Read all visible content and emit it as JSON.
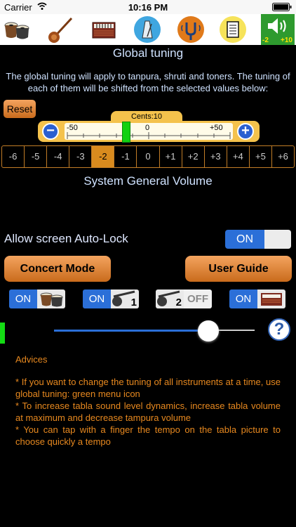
{
  "status": {
    "carrier": "Carrier",
    "time": "10:16 PM"
  },
  "toolbar": {
    "icons": [
      "tabla-icon",
      "sitar-icon",
      "harmonium-icon",
      "metronome-icon",
      "tuning-fork-icon",
      "notes-icon",
      "volume-icon"
    ],
    "volume_minus": "-2",
    "volume_plus": "+10"
  },
  "global_tuning": {
    "title": "Global tuning",
    "description": "The global tuning will apply to tanpura, shruti and toners. The tuning of each of them will be shifted from the selected values below:",
    "reset_label": "Reset",
    "cents_label": "Cents:10",
    "cents_value": 10,
    "scale_min": "-50",
    "scale_mid": "0",
    "scale_max": "+50",
    "semitones": [
      "-6",
      "-5",
      "-4",
      "-3",
      "-2",
      "-1",
      "0",
      "+1",
      "+2",
      "+3",
      "+4",
      "+5",
      "+6"
    ],
    "selected_semitone": "-2"
  },
  "volume": {
    "title": "System General Volume",
    "level": 0.77
  },
  "autolock": {
    "label": "Allow screen Auto-Lock",
    "state": "ON"
  },
  "buttons": {
    "concert": "Concert Mode",
    "guide": "User Guide"
  },
  "instruments": [
    {
      "state": "ON",
      "icon": "tabla-icon"
    },
    {
      "state": "ON",
      "icon": "tanpura-1-icon",
      "number": "1"
    },
    {
      "state": "OFF",
      "icon": "tanpura-2-icon",
      "number": "2"
    },
    {
      "state": "ON",
      "icon": "harmonium-icon"
    }
  ],
  "help": "?",
  "advices": {
    "title": "Advices",
    "items": [
      " * If you want to change the tuning of all instruments at a time, use global tuning: green menu icon",
      " * To increase tabla sound level dynamics, increase tabla volume at maximum and decrease tampura volume",
      " * You can tap with a finger the tempo on the tabla picture to choose quickly a tempo"
    ]
  },
  "colors": {
    "accent_orange": "#e8891f",
    "blue": "#2b6fd8",
    "green": "#14dc14"
  }
}
